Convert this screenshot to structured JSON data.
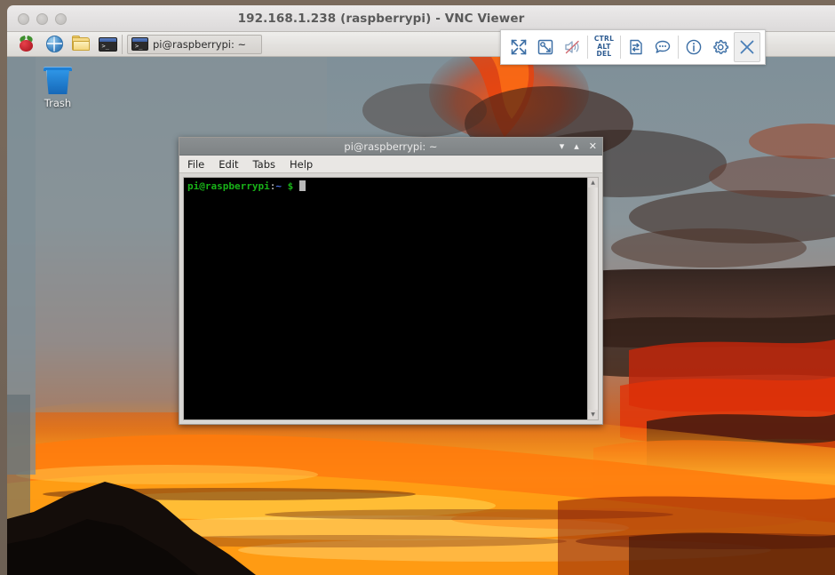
{
  "vnc_window": {
    "title": "192.168.1.238 (raspberrypi) - VNC Viewer",
    "traffic_lights": [
      "close",
      "minimize",
      "zoom"
    ]
  },
  "vnc_toolbar": {
    "buttons": [
      {
        "name": "fullscreen",
        "icon": "expand-arrows-icon",
        "label": ""
      },
      {
        "name": "scale-window",
        "icon": "window-scale-icon",
        "label": ""
      },
      {
        "name": "mute-audio",
        "icon": "speaker-muted-icon",
        "label": ""
      },
      {
        "name": "ctrl-alt-del",
        "icon": "keyboard-icon",
        "label": "CTRL\nALT\nDEL"
      },
      {
        "name": "file-transfer",
        "icon": "file-transfer-icon",
        "label": ""
      },
      {
        "name": "chat",
        "icon": "chat-bubble-icon",
        "label": ""
      },
      {
        "name": "connection-info",
        "icon": "info-circle-icon",
        "label": ""
      },
      {
        "name": "options",
        "icon": "gear-icon",
        "label": ""
      },
      {
        "name": "close-connection",
        "icon": "close-x-icon",
        "label": ""
      }
    ],
    "ctrl_alt_del": {
      "line1": "CTRL",
      "line2": "ALT",
      "line3": "DEL"
    },
    "accent_color": "#3b6ea5"
  },
  "taskbar": {
    "launchers": [
      {
        "name": "menu",
        "icon": "raspberry-pi-logo",
        "tooltip": "Menu"
      },
      {
        "name": "web-browser",
        "icon": "globe-icon",
        "tooltip": "Web Browser"
      },
      {
        "name": "file-manager",
        "icon": "folder-icon",
        "tooltip": "File Manager"
      },
      {
        "name": "terminal",
        "icon": "terminal-icon",
        "tooltip": "Terminal"
      }
    ],
    "windows": [
      {
        "name": "terminal-window-button",
        "label": "pi@raspberrypi: ~",
        "icon": "terminal-icon",
        "active": true
      }
    ]
  },
  "desktop": {
    "icons": [
      {
        "name": "trash",
        "label": "Trash",
        "icon": "trash-can-icon"
      }
    ],
    "wallpaper": {
      "description": "volcanic sunset with fiery orange clouds and mountain silhouette",
      "sky_color": "#7e8f99",
      "cloud_color": "#ff5a10",
      "glow_color": "#ffc24a",
      "mountain_color": "#1a120e"
    }
  },
  "terminal": {
    "title": "pi@raspberrypi: ~",
    "window_buttons": {
      "minimize": "▾",
      "maximize": "▴",
      "close": "✕"
    },
    "menu": [
      "File",
      "Edit",
      "Tabs",
      "Help"
    ],
    "prompt": {
      "user_host": "pi@raspberrypi",
      "separator": ":",
      "path": "~",
      "sigil": "$",
      "command": ""
    },
    "colors": {
      "background": "#000000",
      "user_host": "#18b218",
      "path": "#4b6fe0",
      "text": "#e6e6e6",
      "cursor": "#b9b9b9"
    },
    "scrollbar": {
      "up": "▲",
      "down": "▼"
    }
  }
}
